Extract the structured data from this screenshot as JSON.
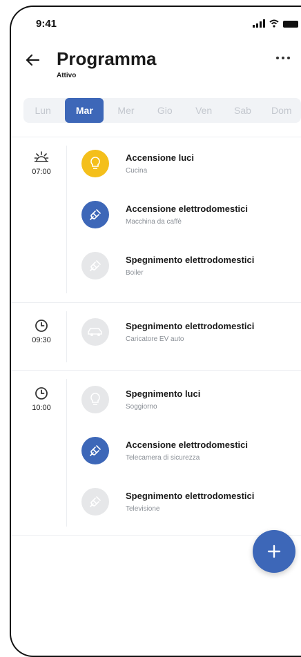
{
  "status_bar": {
    "time": "9:41"
  },
  "header": {
    "title": "Programma",
    "subtitle": "Attivo"
  },
  "days": [
    {
      "label": "Lun",
      "active": false
    },
    {
      "label": "Mar",
      "active": true
    },
    {
      "label": "Mer",
      "active": false
    },
    {
      "label": "Gio",
      "active": false
    },
    {
      "label": "Ven",
      "active": false
    },
    {
      "label": "Sab",
      "active": false
    },
    {
      "label": "Dom",
      "active": false
    }
  ],
  "schedule": [
    {
      "time": "07:00",
      "time_icon": "sunrise-icon",
      "items": [
        {
          "title": "Accensione luci",
          "subtitle": "Cucina",
          "icon": "lightbulb-icon",
          "color": "#f4bf1b",
          "state": "on"
        },
        {
          "title": "Accensione elettrodomestici",
          "subtitle": "Macchina da caffè",
          "icon": "plug-icon",
          "color": "#3d67b8",
          "state": "on"
        },
        {
          "title": "Spegnimento elettrodomestici",
          "subtitle": "Boiler",
          "icon": "plug-icon",
          "color": "#e6e7e9",
          "state": "off"
        }
      ]
    },
    {
      "time": "09:30",
      "time_icon": "clock-icon",
      "items": [
        {
          "title": "Spegnimento elettrodomestici",
          "subtitle": "Caricatore EV auto",
          "icon": "car-icon",
          "color": "#e6e7e9",
          "state": "off"
        }
      ]
    },
    {
      "time": "10:00",
      "time_icon": "clock-icon",
      "items": [
        {
          "title": "Spegnimento luci",
          "subtitle": "Soggiorno",
          "icon": "lightbulb-icon",
          "color": "#e6e7e9",
          "state": "off"
        },
        {
          "title": "Accensione elettrodomestici",
          "subtitle": "Telecamera di sicurezza",
          "icon": "plug-icon",
          "color": "#3d67b8",
          "state": "on"
        },
        {
          "title": "Spegnimento elettrodomestici",
          "subtitle": "Televisione",
          "icon": "plug-icon",
          "color": "#e6e7e9",
          "state": "off"
        }
      ]
    }
  ],
  "fab": {
    "icon": "plus-icon"
  },
  "colors": {
    "accent": "#3d67b8",
    "light_on": "#f4bf1b",
    "off": "#e6e7e9"
  }
}
